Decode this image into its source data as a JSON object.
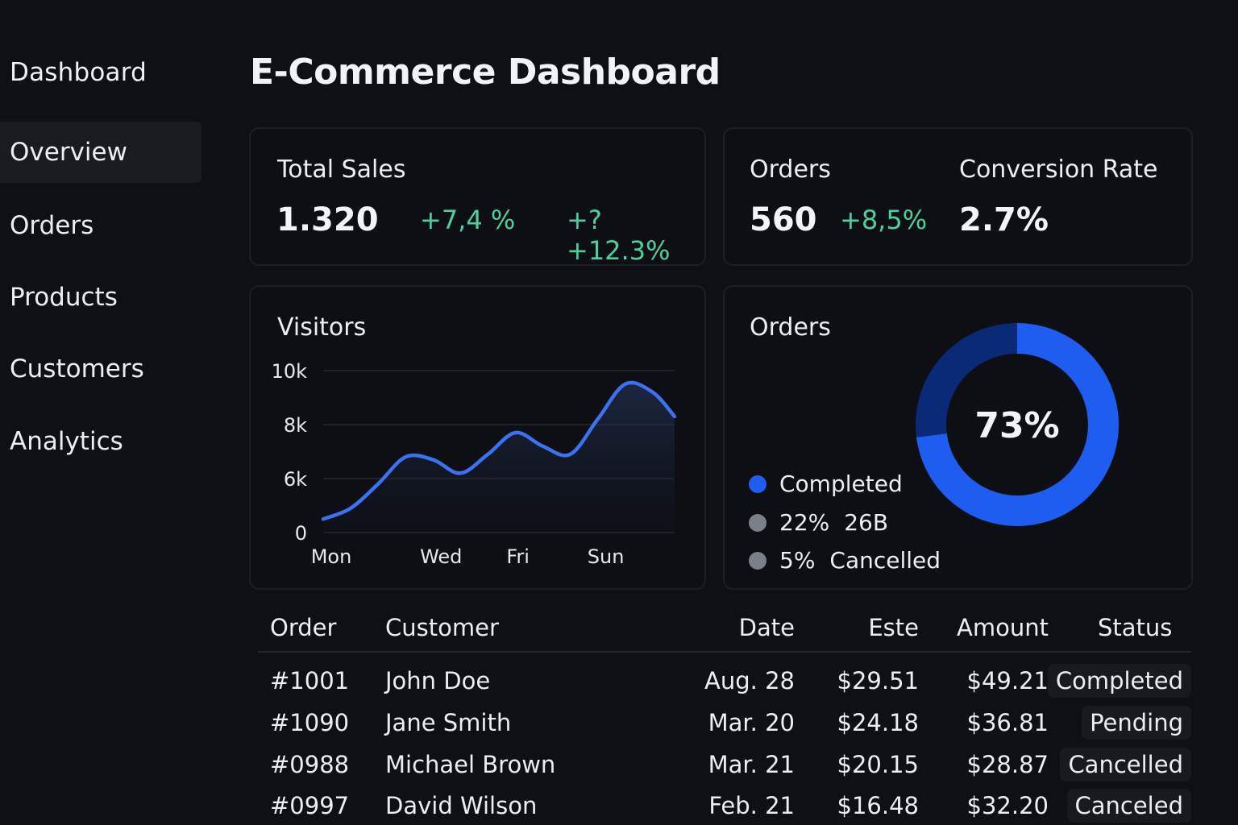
{
  "sidebar": {
    "title": "Dashboard",
    "items": [
      {
        "label": "Overview",
        "active": true
      },
      {
        "label": "Orders"
      },
      {
        "label": "Products"
      },
      {
        "label": "Customers"
      },
      {
        "label": "Analytics"
      }
    ]
  },
  "page": {
    "title": "E-Commerce Dashboard"
  },
  "colors": {
    "accent": "#1f5df0",
    "positive": "#4fd09a",
    "background": "#0e1015",
    "donut_dark": "#0a2a78"
  },
  "stats": {
    "total_sales": {
      "label": "Total Sales",
      "value": "1.320",
      "delta": "+7,4 %",
      "delta2": "+?+12.3%"
    },
    "orders": {
      "label": "Orders",
      "value": "560",
      "delta": "+8,5%"
    },
    "conversion": {
      "label": "Conversion Rate",
      "value": "2.7%"
    }
  },
  "visitors": {
    "title": "Visitors",
    "chart_data": {
      "type": "area",
      "title": "Visitors",
      "y_ticks": [
        "10k",
        "8k",
        "6k",
        "0"
      ],
      "y_tick_values": [
        10000,
        8000,
        6000,
        4000
      ],
      "x_ticks": [
        "Mon",
        "Wed",
        "Fri",
        "Sun"
      ],
      "ylim": [
        4000,
        10000
      ],
      "grid": true,
      "x": [
        0,
        0.5,
        1,
        1.5,
        2,
        2.5,
        3,
        3.5,
        4,
        4.5,
        5,
        5.5,
        6,
        6.4
      ],
      "values": [
        4500,
        4900,
        5800,
        6800,
        6700,
        6200,
        6900,
        7700,
        7200,
        6900,
        8200,
        9500,
        9200,
        8300
      ]
    }
  },
  "orders_breakdown": {
    "title": "Orders",
    "center_label": "73%",
    "chart_data": {
      "type": "pie",
      "title": "Orders",
      "slices": [
        {
          "label": "Completed",
          "value": 73,
          "color": "#1f5df0"
        },
        {
          "label": "26B",
          "value": 22,
          "color": "#0a2a78"
        },
        {
          "label": "Cancelled",
          "value": 5,
          "color": "#0a2a78"
        }
      ]
    },
    "legend": [
      {
        "pct": "",
        "label": "Completed",
        "color": "#1f5df0"
      },
      {
        "pct": "22%",
        "label": "26B",
        "color": "#7b7f88"
      },
      {
        "pct": "5%",
        "label": "Cancelled",
        "color": "#7b7f88"
      }
    ]
  },
  "table": {
    "headers": {
      "order": "Order",
      "customer": "Customer",
      "date": "Date",
      "este": "Este",
      "amount": "Amount",
      "status": "Status"
    },
    "rows": [
      {
        "order": "#1001",
        "customer": "John Doe",
        "date": "Aug. 28",
        "este": "$29.51",
        "amount": "$49.21",
        "status": "Completed"
      },
      {
        "order": "#1090",
        "customer": "Jane Smith",
        "date": "Mar. 20",
        "este": "$24.18",
        "amount": "$36.81",
        "status": "Pending"
      },
      {
        "order": "#0988",
        "customer": "Michael Brown",
        "date": "Mar. 21",
        "este": "$20.15",
        "amount": "$28.87",
        "status": "Cancelled"
      },
      {
        "order": "#0997",
        "customer": "David Wilson",
        "date": "Feb. 21",
        "este": "$16.48",
        "amount": "$32.20",
        "status": "Canceled"
      }
    ]
  }
}
